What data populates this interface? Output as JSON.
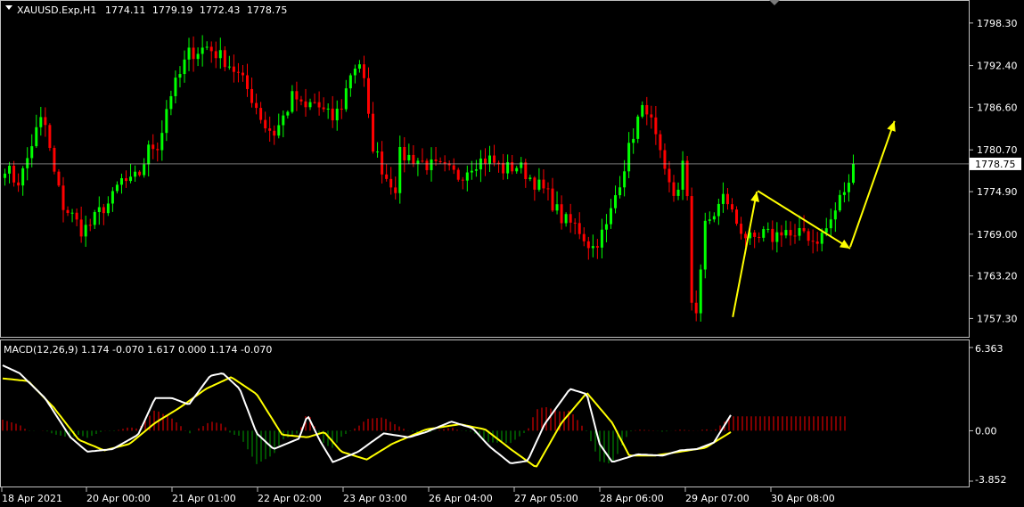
{
  "chart_data": [
    {
      "type": "candlestick",
      "symbol": "XAUUSD.Exp,H1",
      "ohlc_readout": {
        "open": "1774.11",
        "high": "1779.19",
        "low": "1772.43",
        "close": "1778.75"
      },
      "current_price": 1778.75,
      "current_price_label": "1778.75",
      "ylim": [
        1755.0,
        1801.0
      ],
      "y_ticks": [
        "1798.30",
        "1792.40",
        "1786.60",
        "1780.70",
        "1774.90",
        "1769.00",
        "1763.20",
        "1757.30"
      ],
      "x_ticks": [
        "18 Apr 2021",
        "20 Apr 00:00",
        "21 Apr 01:00",
        "22 Apr 02:00",
        "23 Apr 03:00",
        "26 Apr 04:00",
        "27 Apr 05:00",
        "28 Apr 06:00",
        "29 Apr 07:00",
        "30 Apr 08:00"
      ],
      "colors": {
        "bull": "#00ff00",
        "bear": "#ff0000",
        "price_line": "#c0c0c0",
        "arrow": "#ffff00"
      },
      "candle_count": 190,
      "path_anchors": [
        [
          0,
          1778.5
        ],
        [
          5,
          1776.0
        ],
        [
          8,
          1778.0
        ],
        [
          12,
          1782.5
        ],
        [
          16,
          1785.5
        ],
        [
          20,
          1778.0
        ],
        [
          24,
          1773.0
        ],
        [
          28,
          1771.5
        ],
        [
          32,
          1769.5
        ],
        [
          36,
          1770.5
        ],
        [
          40,
          1772.5
        ],
        [
          44,
          1773.5
        ],
        [
          48,
          1776.5
        ],
        [
          52,
          1776.0
        ],
        [
          56,
          1777.5
        ],
        [
          60,
          1781.0
        ],
        [
          64,
          1781.5
        ],
        [
          68,
          1788.0
        ],
        [
          72,
          1790.5
        ],
        [
          76,
          1794.0
        ],
        [
          80,
          1794.5
        ],
        [
          84,
          1795.0
        ],
        [
          88,
          1794.0
        ],
        [
          92,
          1793.0
        ],
        [
          96,
          1791.5
        ],
        [
          100,
          1789.5
        ],
        [
          104,
          1787.0
        ],
        [
          108,
          1784.0
        ],
        [
          112,
          1783.0
        ],
        [
          116,
          1785.5
        ],
        [
          120,
          1788.5
        ],
        [
          124,
          1786.0
        ],
        [
          128,
          1787.5
        ],
        [
          132,
          1786.0
        ],
        [
          136,
          1785.0
        ],
        [
          140,
          1787.0
        ],
        [
          144,
          1792.0
        ],
        [
          148,
          1793.0
        ],
        [
          152,
          1782.0
        ],
        [
          158,
          1777.0
        ],
        [
          164,
          1775.0
        ]
      ],
      "path_anchors_2": [
        [
          0,
          1780.0
        ],
        [
          6,
          1779.5
        ],
        [
          12,
          1778.5
        ],
        [
          18,
          1778.0
        ],
        [
          24,
          1777.0
        ],
        [
          30,
          1779.0
        ],
        [
          36,
          1779.5
        ],
        [
          42,
          1778.0
        ],
        [
          48,
          1778.5
        ],
        [
          54,
          1776.5
        ],
        [
          60,
          1774.5
        ],
        [
          66,
          1771.0
        ],
        [
          72,
          1770.0
        ],
        [
          78,
          1767.0
        ],
        [
          84,
          1770.0
        ],
        [
          88,
          1775.0
        ],
        [
          92,
          1779.5
        ],
        [
          96,
          1784.5
        ],
        [
          100,
          1787.0
        ],
        [
          104,
          1782.0
        ],
        [
          108,
          1776.5
        ],
        [
          112,
          1774.0
        ],
        [
          116,
          1780.5
        ],
        [
          118,
          1760.5
        ],
        [
          120,
          1757.5
        ],
        [
          124,
          1770.0
        ],
        [
          128,
          1772.0
        ],
        [
          132,
          1774.5
        ],
        [
          136,
          1771.0
        ],
        [
          140,
          1769.0
        ],
        [
          144,
          1767.5
        ],
        [
          148,
          1769.0
        ],
        [
          152,
          1768.5
        ],
        [
          156,
          1770.0
        ],
        [
          160,
          1768.0
        ],
        [
          164,
          1769.5
        ],
        [
          168,
          1768.0
        ],
        [
          172,
          1769.0
        ],
        [
          176,
          1771.5
        ],
        [
          180,
          1775.0
        ],
        [
          184,
          1776.0
        ],
        [
          186,
          1774.5
        ]
      ],
      "annotations": {
        "arrow_1": {
          "from": [
            1757.5,
            0.79
          ],
          "to": [
            1774.9,
            0.816
          ]
        },
        "arrow_2": {
          "from": [
            1775.0,
            0.817
          ],
          "to": [
            1767.0,
            0.917
          ]
        },
        "arrow_3": {
          "from": [
            1767.2,
            0.917
          ],
          "to": [
            1784.7,
            0.965
          ]
        }
      }
    },
    {
      "type": "macd",
      "label": "MACD(12,26,9) 1.174 -0.070 1.617 0.000 1.174 -0.070",
      "y_ticks": [
        "6.363",
        "0.00",
        "-3.852"
      ],
      "ylim": [
        -3.852,
        6.363
      ],
      "colors": {
        "macd_line": "#ffffff",
        "signal_line": "#ffff00",
        "hist_pos": "#ff0000",
        "hist_neg": "#00a000"
      },
      "macd_anchors": [
        [
          0,
          5.0
        ],
        [
          0.02,
          4.4
        ],
        [
          0.05,
          2.5
        ],
        [
          0.08,
          -0.5
        ],
        [
          0.1,
          -1.6
        ],
        [
          0.13,
          -1.4
        ],
        [
          0.16,
          -0.3
        ],
        [
          0.18,
          2.5
        ],
        [
          0.2,
          2.5
        ],
        [
          0.22,
          2.0
        ],
        [
          0.245,
          4.2
        ],
        [
          0.26,
          4.4
        ],
        [
          0.28,
          3.2
        ],
        [
          0.3,
          -0.2
        ],
        [
          0.32,
          -1.4
        ],
        [
          0.35,
          -0.6
        ],
        [
          0.36,
          1.2
        ],
        [
          0.375,
          -0.8
        ],
        [
          0.39,
          -2.4
        ],
        [
          0.42,
          -1.6
        ],
        [
          0.45,
          -0.2
        ],
        [
          0.48,
          -0.5
        ],
        [
          0.5,
          -0.1
        ],
        [
          0.53,
          0.7
        ],
        [
          0.555,
          0.2
        ],
        [
          0.575,
          -1.2
        ],
        [
          0.6,
          -2.5
        ],
        [
          0.62,
          -2.3
        ],
        [
          0.64,
          0.5
        ],
        [
          0.67,
          3.2
        ],
        [
          0.69,
          2.8
        ],
        [
          0.705,
          -1.0
        ],
        [
          0.72,
          -2.4
        ],
        [
          0.75,
          -1.8
        ],
        [
          0.78,
          -1.9
        ],
        [
          0.8,
          -1.5
        ],
        [
          0.82,
          -1.4
        ],
        [
          0.84,
          -0.9
        ],
        [
          0.86,
          1.2
        ]
      ],
      "signal_anchors": [
        [
          0,
          4.0
        ],
        [
          0.03,
          3.8
        ],
        [
          0.06,
          1.8
        ],
        [
          0.09,
          -0.7
        ],
        [
          0.12,
          -1.5
        ],
        [
          0.15,
          -1.0
        ],
        [
          0.18,
          0.6
        ],
        [
          0.21,
          1.8
        ],
        [
          0.24,
          3.2
        ],
        [
          0.27,
          4.1
        ],
        [
          0.3,
          2.8
        ],
        [
          0.33,
          -0.3
        ],
        [
          0.36,
          -0.5
        ],
        [
          0.38,
          -0.1
        ],
        [
          0.4,
          -1.6
        ],
        [
          0.43,
          -2.2
        ],
        [
          0.46,
          -1.0
        ],
        [
          0.5,
          0.1
        ],
        [
          0.54,
          0.5
        ],
        [
          0.57,
          0.1
        ],
        [
          0.6,
          -1.4
        ],
        [
          0.63,
          -2.8
        ],
        [
          0.66,
          0.6
        ],
        [
          0.69,
          2.9
        ],
        [
          0.72,
          0.6
        ],
        [
          0.74,
          -1.9
        ],
        [
          0.77,
          -1.9
        ],
        [
          0.8,
          -1.6
        ],
        [
          0.83,
          -1.3
        ],
        [
          0.86,
          -0.1
        ]
      ]
    }
  ]
}
